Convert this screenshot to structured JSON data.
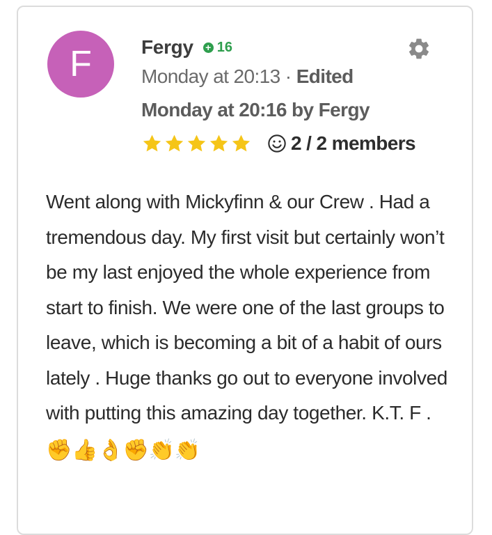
{
  "post": {
    "author": {
      "initial": "F",
      "name": "Fergy",
      "reputation": "16",
      "avatar_color": "#c661b8"
    },
    "date_posted": "Monday at 20:13",
    "separator": " · ",
    "edited_label": "Edited",
    "edited_detail": "Monday at 20:16 by Fergy",
    "rating": 5,
    "reaction_icon": "smiley-face-icon",
    "reaction_count": "2 / 2 members",
    "body": "Went along with Mickyfinn & our Crew . Had a tremendous day. My first visit but certainly won’t be my last enjoyed the whole experience from start to finish. We were one of the last groups to leave, which is becoming a bit of a habit of ours lately . Huge thanks go out to everyone involved with putting this amazing day together. K.T. F . ",
    "emojis": [
      "✊",
      "👍",
      "👌",
      "✊",
      "👏",
      "👏"
    ]
  },
  "colors": {
    "reputation_green": "#2e9e4d",
    "star_gold": "#f5c518",
    "gear_gray": "#8a8a8a"
  }
}
